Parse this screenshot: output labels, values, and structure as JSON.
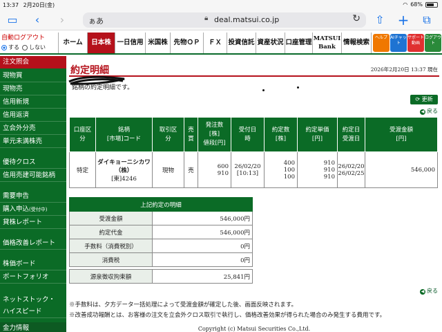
{
  "status_bar": {
    "time": "13:37",
    "date": "2月20日(金)",
    "battery": "68%"
  },
  "browser": {
    "text_size_label": "ぁあ",
    "url": "deal.matsui.co.jp"
  },
  "top_nav": {
    "auto_logout": {
      "title": "自動ログアウト",
      "on_label": "する",
      "off_label": "しない",
      "selected": "する"
    },
    "tabs": [
      "ホーム",
      "日本株",
      "一日信用",
      "米国株",
      "先物ＯＰ",
      "ＦＸ",
      "投資信託",
      "資産状況",
      "口座管理",
      "MATSUI Bank",
      "情報検索"
    ],
    "active_tab": "日本株",
    "icon_buttons": [
      {
        "label": "ヘルプ",
        "icon": "help-icon",
        "color": "#f07800"
      },
      {
        "label": "AIチャット",
        "icon": "ai-chat-icon",
        "color": "#1e73d2"
      },
      {
        "label": "サポート動画",
        "icon": "support-video-icon",
        "color": "#e03030"
      },
      {
        "label": "ログアウト",
        "icon": "logout-icon",
        "color": "#2a8a3a"
      }
    ]
  },
  "sidebar": {
    "header": "注文照会",
    "items": [
      {
        "label": "現物買"
      },
      {
        "label": "現物売"
      },
      {
        "label": "信用新規"
      },
      {
        "label": "信用返済"
      },
      {
        "label": "立会外分売"
      },
      {
        "label": "単元未満株売"
      },
      {
        "label": "優待クロス"
      },
      {
        "label": "信用売建可能銘柄"
      },
      {
        "label": "需要申告"
      },
      {
        "label": "購入申込",
        "suffix": "(受付中)"
      },
      {
        "label": "貸株レポート"
      },
      {
        "label": "価格改善レポート"
      },
      {
        "label": "株価ボード"
      },
      {
        "label": "ポートフォリオ"
      },
      {
        "label": "ネットストック・"
      },
      {
        "label": "ハイスピード"
      },
      {
        "label": "金力情報"
      }
    ]
  },
  "main": {
    "title": "約定明細",
    "timestamp": "2026年2月20日 13:37 現在",
    "intro": "銘柄の約定明細です。",
    "update_button": "更新",
    "back_link": "戻る",
    "orders_table": {
      "headers": [
        {
          "line1": "口座区",
          "line2": "分"
        },
        {
          "line1": "銘柄",
          "line2": "[市場]コード"
        },
        {
          "line1": "取引区",
          "line2": "分"
        },
        {
          "line1": "売",
          "line2": "買"
        },
        {
          "line1": "発注数",
          "line2": "[株]",
          "line3": "値段[円]"
        },
        {
          "line1": "受付日",
          "line2": "時"
        },
        {
          "line1": "約定数",
          "line2": "[株]"
        },
        {
          "line1": "約定単価",
          "line2": "[円]"
        },
        {
          "line1": "約定日",
          "line2": "受渡日"
        },
        {
          "line1": "受渡金額",
          "line2": "[円]"
        }
      ],
      "row": {
        "account": "特定",
        "name_line1": "ダイキョーニシカワ",
        "name_line2": "（株）",
        "market_code": "[東]4246",
        "trade_type": "現物",
        "side": "売",
        "order_qty": "600",
        "order_price": "910",
        "received_date": "26/02/20",
        "received_time": "[10:13]",
        "exec_qty": [
          "400",
          "100",
          "100"
        ],
        "exec_price": [
          "910",
          "910",
          "910"
        ],
        "exec_date": "26/02/20",
        "settle_date": "26/02/25",
        "settle_amount": "546,000"
      }
    },
    "details_table": {
      "header": "上記約定の明細",
      "rows": [
        {
          "label": "受渡金額",
          "value": "546,000円"
        },
        {
          "label": "約定代金",
          "value": "546,000円"
        },
        {
          "label": "手数料（消費税別）",
          "value": "0円"
        },
        {
          "label": "消費税",
          "value": "0円"
        }
      ],
      "withholding": {
        "label": "源泉徴収拘束額",
        "value": "25,841円"
      }
    },
    "notes": [
      "※手数料は、夕方データ一括処理によって受渡金額が確定した後、画面反映されます。",
      "※改善成功報酬とは、お客様の注文を立会外クロス取引で執行し、価格改善効果が得られた場合のみ発生する費用です。"
    ],
    "copyright": "Copyright (c) Matsui Securities Co.,Ltd."
  }
}
